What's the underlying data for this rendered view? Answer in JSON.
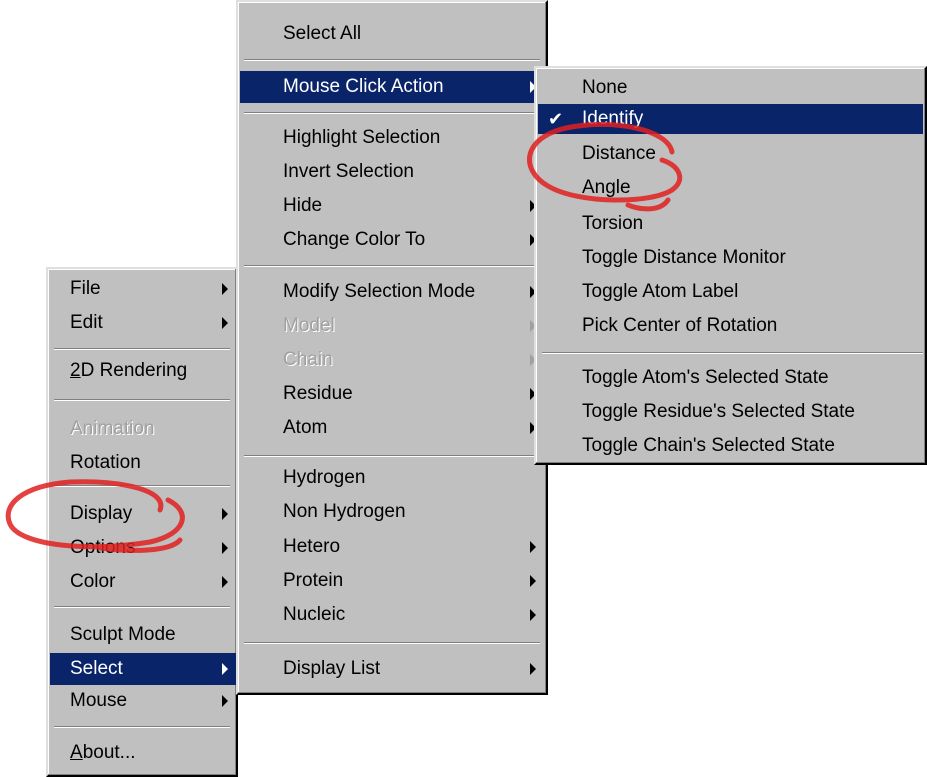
{
  "main_menu": {
    "items": [
      {
        "label": "File",
        "submenu": true
      },
      {
        "label": "Edit",
        "submenu": true
      },
      {
        "label_prefix": "2",
        "label_rest": "D Rendering"
      },
      {
        "label": "Animation",
        "disabled": true
      },
      {
        "label": "Rotation"
      },
      {
        "label": "Display",
        "submenu": true
      },
      {
        "label": "Options",
        "submenu": true
      },
      {
        "label": "Color",
        "submenu": true
      },
      {
        "label": "Sculpt Mode"
      },
      {
        "label": "Select",
        "submenu": true,
        "selected": true
      },
      {
        "label": "Mouse",
        "submenu": true
      },
      {
        "label_prefix": "A",
        "label_rest": "bout..."
      }
    ]
  },
  "select_menu": {
    "items": [
      {
        "label": "Select All"
      },
      {
        "label": "Mouse Click Action",
        "submenu": true,
        "selected": true
      },
      {
        "label": "Highlight Selection"
      },
      {
        "label": "Invert Selection"
      },
      {
        "label": "Hide",
        "submenu": true
      },
      {
        "label": "Change Color To",
        "submenu": true
      },
      {
        "label": "Modify Selection Mode",
        "submenu": true
      },
      {
        "label": "Model",
        "submenu": true,
        "disabled": true
      },
      {
        "label": "Chain",
        "submenu": true,
        "disabled": true
      },
      {
        "label": "Residue",
        "submenu": true
      },
      {
        "label": "Atom",
        "submenu": true
      },
      {
        "label": "Hydrogen"
      },
      {
        "label": "Non Hydrogen"
      },
      {
        "label": "Hetero",
        "submenu": true
      },
      {
        "label": "Protein",
        "submenu": true
      },
      {
        "label": "Nucleic",
        "submenu": true
      },
      {
        "label": "Display List",
        "submenu": true
      }
    ]
  },
  "click_action_menu": {
    "check_mark": "✔",
    "items": [
      {
        "label": "None"
      },
      {
        "label": "Identify",
        "selected": true,
        "checked": true
      },
      {
        "label": "Distance"
      },
      {
        "label": "Angle"
      },
      {
        "label": "Torsion"
      },
      {
        "label": "Toggle Distance Monitor"
      },
      {
        "label": "Toggle Atom Label"
      },
      {
        "label": "Pick Center of Rotation"
      },
      {
        "label": "Toggle Atom's Selected State"
      },
      {
        "label": "Toggle Residue's Selected State"
      },
      {
        "label": "Toggle Chain's Selected State"
      }
    ]
  },
  "colors": {
    "menu_bg": "#c0c0c0",
    "highlight": "#0a246a",
    "annotation": "#e02020"
  }
}
